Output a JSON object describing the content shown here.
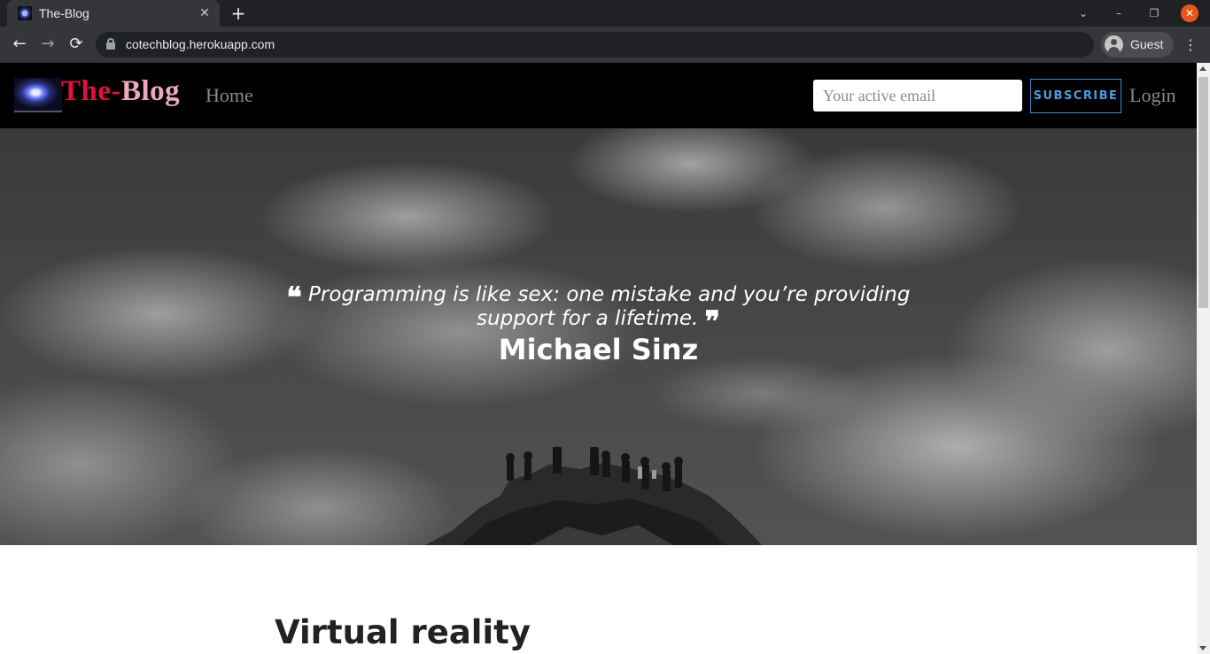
{
  "browser": {
    "tab_title": "The-Blog",
    "tab_close": "✕",
    "new_tab": "+",
    "url": "cotechblog.herokuapp.com",
    "profile_label": "Guest",
    "back": "←",
    "forward": "→",
    "reload": "⟳",
    "menu": "⋮",
    "tab_search": "⌄",
    "minimize": "–",
    "restore": "❐",
    "close": "✕"
  },
  "site": {
    "brand_the": "The-",
    "brand_blog": "Blog",
    "home_label": "Home",
    "email_placeholder": "Your active email",
    "subscribe_label": "SUBSCRIBE",
    "login_label": "Login",
    "colors": {
      "brand_red": "#e0103a",
      "brand_pink": "#f0a7bd",
      "subscribe_blue": "#4a9fe0"
    }
  },
  "hero": {
    "open_quote": "❝",
    "quote": "Programming is like sex: one mistake and you’re providing support for a lifetime.",
    "close_quote": "❞",
    "author": "Michael Sinz"
  },
  "post": {
    "title": "Virtual reality"
  }
}
